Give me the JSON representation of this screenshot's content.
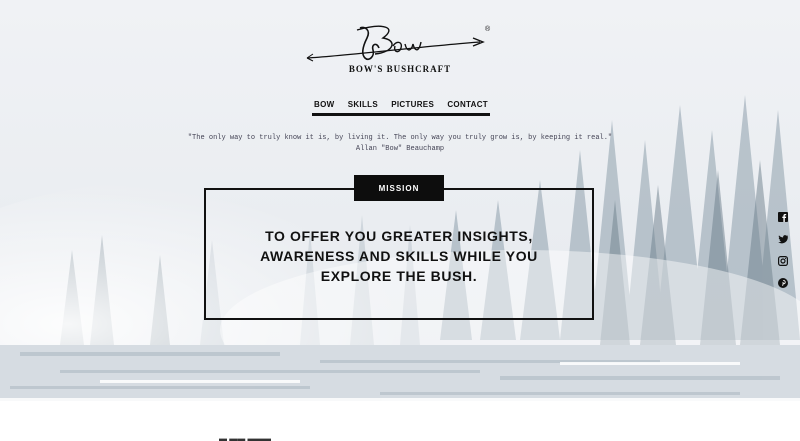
{
  "brand": {
    "script": "Bow",
    "name": "BOW'S BUSHCRAFT",
    "mark": "®"
  },
  "nav": {
    "items": [
      "BOW",
      "SKILLS",
      "PICTURES",
      "CONTACT"
    ]
  },
  "quote": {
    "text": "\"The only way to truly know it is, by living it. The only way you truly grow is, by keeping it real.\"",
    "author": "Allan \"Bow\" Beauchamp"
  },
  "mission": {
    "label": "MISSION",
    "text": "TO OFFER YOU GREATER INSIGHTS,\nAWARENESS AND SKILLS WHILE YOU\nEXPLORE THE BUSH."
  },
  "social": {
    "icons": [
      "facebook-icon",
      "twitter-icon",
      "instagram-icon",
      "pinterest-icon"
    ]
  },
  "colors": {
    "text": "#111111",
    "tag_bg": "#0d0d0d",
    "sky": "#eef1f4"
  }
}
